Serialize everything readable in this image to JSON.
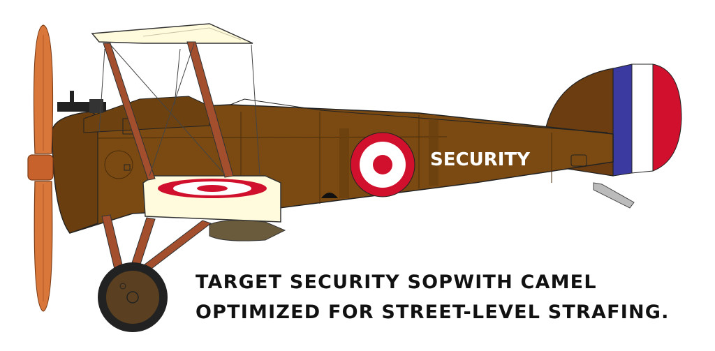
{
  "fuselage_marking": "SECURITY",
  "caption": {
    "line1": "TARGET SECURITY SOPWITH CAMEL",
    "line2": "OPTIMIZED FOR STREET-LEVEL STRAFING."
  },
  "colors": {
    "fuselage": "#7a4a12",
    "fuselage_dark": "#5e3a10",
    "tail": "#6b3d10",
    "propeller": "#d9773a",
    "roundel_red": "#d0102c",
    "rudder_blue": "#3a3aa0",
    "rudder_red": "#d0102c",
    "wing_cream": "#fffbdc",
    "strut_brown": "#a34e2c",
    "wheel": "#4a3318"
  },
  "icons": [
    "propeller-icon",
    "machine-gun-icon",
    "roundel-icon",
    "rudder-stripes-icon",
    "wheel-icon"
  ]
}
